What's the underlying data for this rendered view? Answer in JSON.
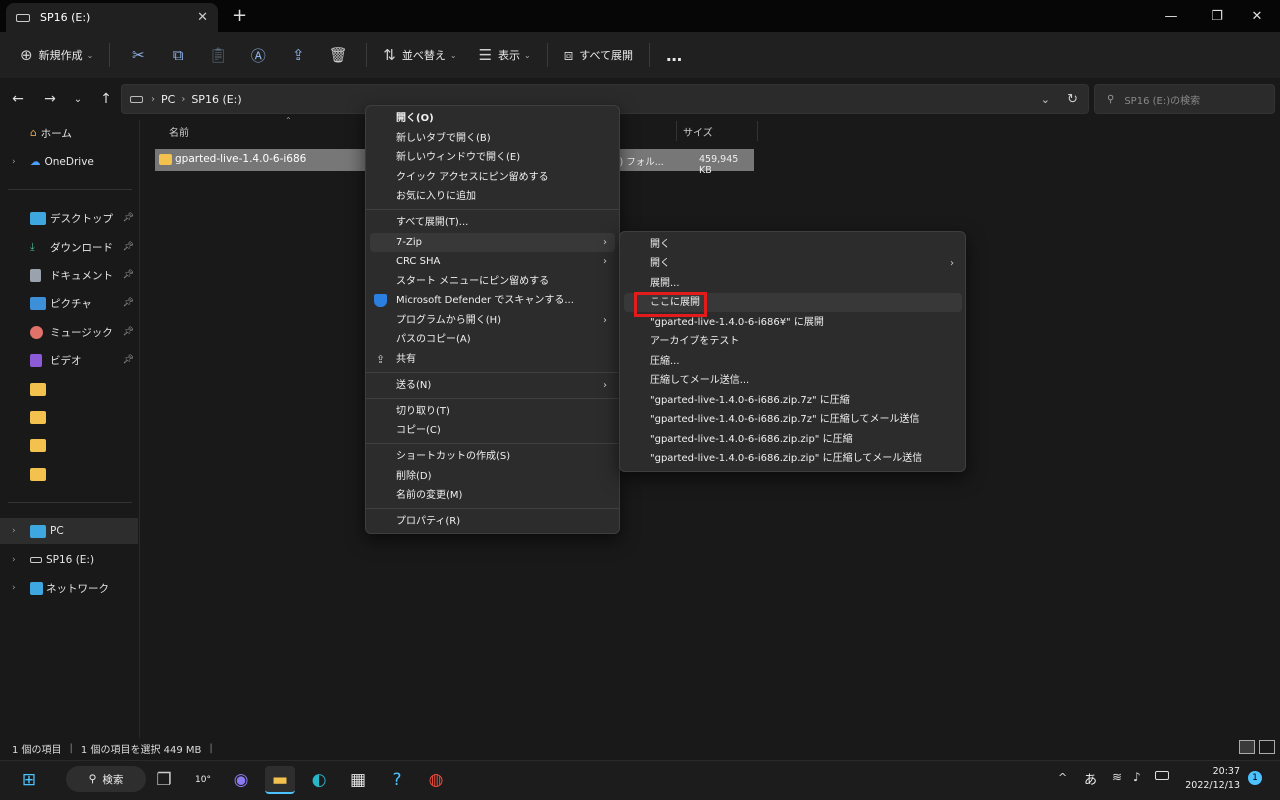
{
  "window": {
    "tab_title": "SP16 (E:)",
    "close_tab": "✕",
    "new_tab": "+",
    "min": "—",
    "restore": "❐",
    "close": "✕"
  },
  "toolbar": {
    "new_label": "新規作成",
    "sort_label": "並べ替え",
    "view_label": "表示",
    "extract_all_label": "すべて展開",
    "more": "…"
  },
  "address": {
    "crumbs": [
      "PC",
      "SP16 (E:)"
    ],
    "search_placeholder": "SP16 (E:)の検索"
  },
  "sidebar": {
    "home": "ホーム",
    "onedrive": "OneDrive",
    "desktop": "デスクトップ",
    "downloads": "ダウンロード",
    "documents": "ドキュメント",
    "pictures": "ピクチャ",
    "music": "ミュージック",
    "videos": "ビデオ",
    "pc": "PC",
    "sp16": "SP16 (E:)",
    "network": "ネットワーク"
  },
  "columns": {
    "name": "名前",
    "size": "サイズ"
  },
  "file": {
    "name": "gparted-live-1.4.0-6-i686",
    "type": "式) フォル...",
    "size": "459,945 KB"
  },
  "context_menu": {
    "open": "開く(O)",
    "open_new_tab": "新しいタブで開く(B)",
    "open_new_window": "新しいウィンドウで開く(E)",
    "pin_quick_access": "クイック アクセスにピン留めする",
    "add_favorites": "お気に入りに追加",
    "extract_all": "すべて展開(T)...",
    "seven_zip": "7-Zip",
    "crc_sha": "CRC SHA",
    "pin_start": "スタート メニューにピン留めする",
    "defender": "Microsoft Defender でスキャンする...",
    "open_with": "プログラムから開く(H)",
    "copy_path": "パスのコピー(A)",
    "share": "共有",
    "send_to": "送る(N)",
    "cut": "切り取り(T)",
    "copy": "コピー(C)",
    "create_shortcut": "ショートカットの作成(S)",
    "delete": "削除(D)",
    "rename": "名前の変更(M)",
    "properties": "プロパティ(R)"
  },
  "submenu": {
    "open1": "開く",
    "open2": "開く",
    "extract": "展開...",
    "extract_here": "ここに展開",
    "extract_to": "\"gparted-live-1.4.0-6-i686¥\" に展開",
    "test": "アーカイブをテスト",
    "compress": "圧縮...",
    "compress_email": "圧縮してメール送信...",
    "compress_7z": "\"gparted-live-1.4.0-6-i686.zip.7z\" に圧縮",
    "compress_7z_email": "\"gparted-live-1.4.0-6-i686.zip.7z\" に圧縮してメール送信",
    "compress_zip": "\"gparted-live-1.4.0-6-i686.zip.zip\" に圧縮",
    "compress_zip_email": "\"gparted-live-1.4.0-6-i686.zip.zip\" に圧縮してメール送信"
  },
  "status": {
    "count": "1 個の項目",
    "selected": "1 個の項目を選択  449 MB"
  },
  "taskbar": {
    "search": "検索",
    "weather": "10°",
    "ime": "あ",
    "time": "20:37",
    "date": "2022/12/13",
    "notifications": "1"
  }
}
